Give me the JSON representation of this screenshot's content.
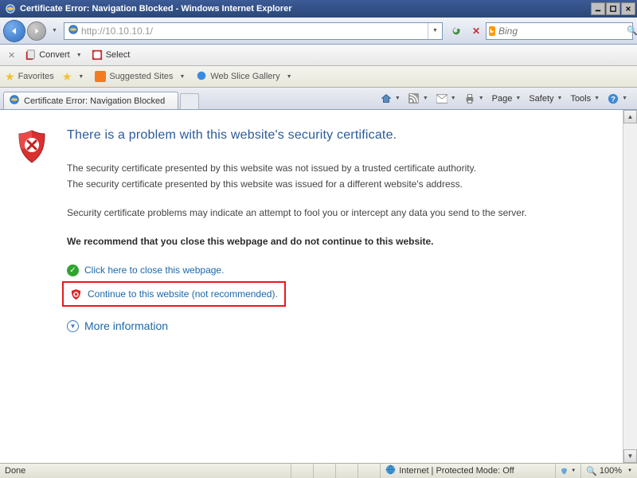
{
  "titlebar": {
    "title": "Certificate Error: Navigation Blocked - Windows Internet Explorer"
  },
  "navbar": {
    "url": "http://10.10.10.1/",
    "search_placeholder": "Bing"
  },
  "convertbar": {
    "convert_label": "Convert",
    "select_label": "Select"
  },
  "favbar": {
    "favorites": "Favorites",
    "suggested": "Suggested Sites",
    "webslice": "Web Slice Gallery"
  },
  "tabbar": {
    "tab_title": "Certificate Error: Navigation Blocked",
    "cmd_page": "Page",
    "cmd_safety": "Safety",
    "cmd_tools": "Tools"
  },
  "cert": {
    "heading": "There is a problem with this website's security certificate.",
    "p1": "The security certificate presented by this website was not issued by a trusted certificate authority.",
    "p2": "The security certificate presented by this website was issued for a different website's address.",
    "p3": "Security certificate problems may indicate an attempt to fool you or intercept any data you send to the server.",
    "recommend": "We recommend that you close this webpage and do not continue to this website.",
    "close_link": "Click here to close this webpage.",
    "continue_link": "Continue to this website (not recommended).",
    "more_info": "More information"
  },
  "statusbar": {
    "left": "Done",
    "zone": "Internet | Protected Mode: Off",
    "zoom": "100%"
  }
}
